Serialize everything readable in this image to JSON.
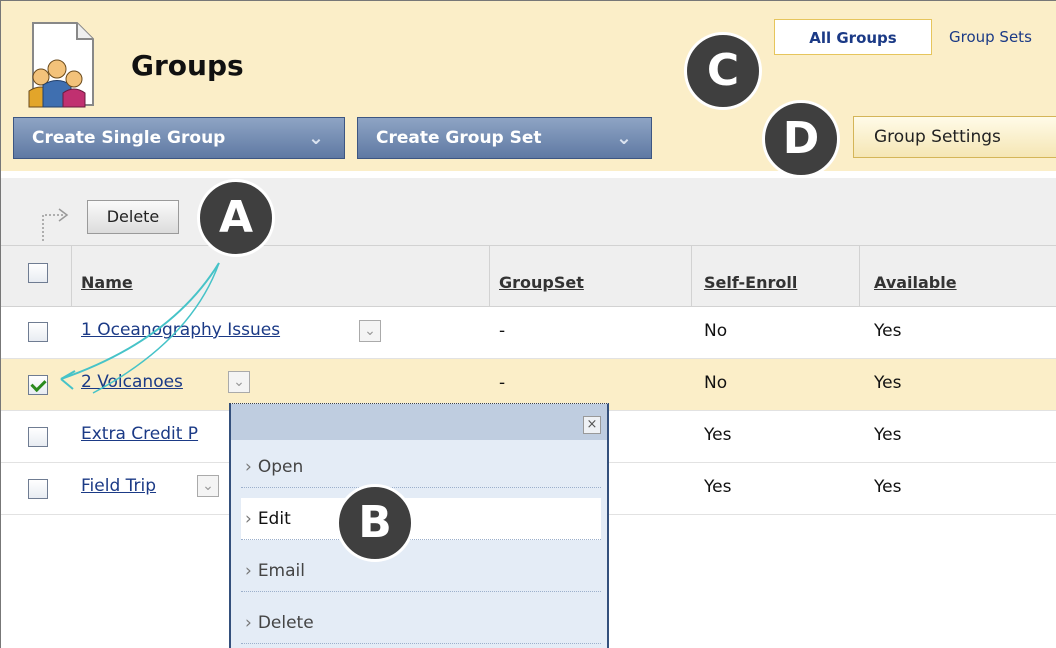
{
  "header": {
    "title": "Groups",
    "tabs": [
      {
        "label": "All Groups",
        "active": true
      },
      {
        "label": "Group Sets"
      }
    ],
    "create_single_label": "Create Single Group",
    "create_set_label": "Create Group Set",
    "settings_label": "Group Settings",
    "accent_color": "#5f79a3",
    "header_bg": "#fbeec8"
  },
  "toolbar": {
    "delete_label": "Delete"
  },
  "table": {
    "columns": [
      "Name",
      "GroupSet",
      "Self-Enroll",
      "Available"
    ],
    "rows": [
      {
        "name": "1 Oceanography Issues",
        "groupset": "-",
        "self_enroll": "No",
        "available": "Yes",
        "checked": false
      },
      {
        "name": "2 Volcanoes",
        "groupset": "-",
        "self_enroll": "No",
        "available": "Yes",
        "checked": true
      },
      {
        "name": "Extra Credit P",
        "groupset": "",
        "self_enroll": "Yes",
        "available": "Yes",
        "checked": false
      },
      {
        "name": "Field Trip",
        "groupset": "",
        "self_enroll": "Yes",
        "available": "Yes",
        "checked": false
      }
    ]
  },
  "context_menu": {
    "close_glyph": "×",
    "items": [
      "Open",
      "Edit",
      "Email",
      "Delete"
    ],
    "active_item": "Edit"
  },
  "callouts": {
    "a": "A",
    "b": "B",
    "c": "C",
    "d": "D"
  },
  "icons": {
    "page_icon": "group-people-icon",
    "toolbar_icon": "arrow-right-icon",
    "chevron": "double-chevron-down-icon",
    "close": "close-icon",
    "checkbox_check_color": "#2b8a1d"
  }
}
